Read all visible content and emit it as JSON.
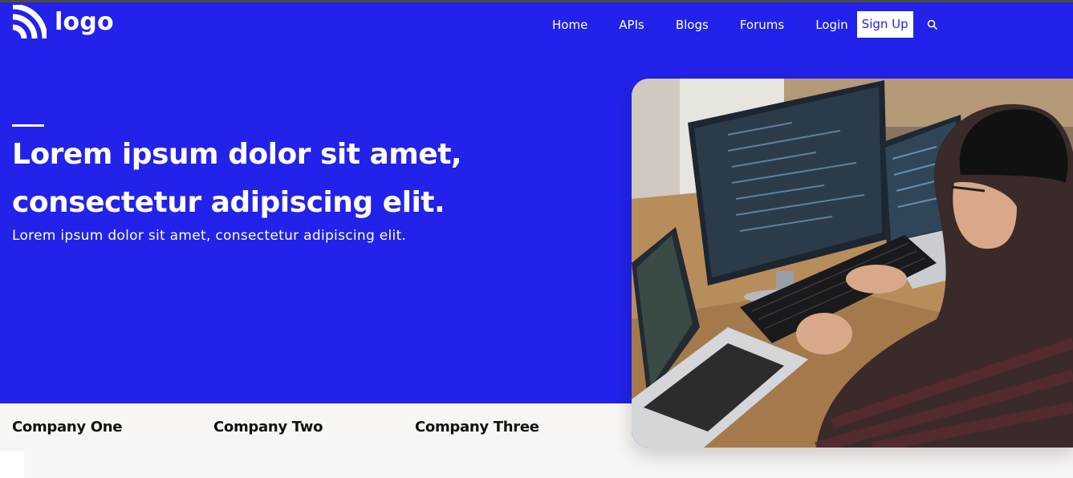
{
  "header": {
    "logo_text": "logo",
    "logo_icon": "wifi-signal-icon",
    "nav": {
      "home": "Home",
      "apis": "APIs",
      "blogs": "Blogs",
      "forums": "Forums",
      "login": "Login",
      "signup": "Sign Up"
    },
    "search_icon": "search-icon"
  },
  "hero": {
    "title_line1": "Lorem ipsum dolor sit amet,",
    "title_line2": "consectetur adipiscing elit.",
    "subtitle": "Lorem ipsum dolor sit amet, consectetur adipiscing elit.",
    "image": "developer-at-computer-photo"
  },
  "companies": [
    "Company One",
    "Company Two",
    "Company Three"
  ],
  "colors": {
    "brand_blue": "#2222ea",
    "white": "#ffffff",
    "page_bg": "#f8f6f4",
    "company_text": "#111111"
  }
}
